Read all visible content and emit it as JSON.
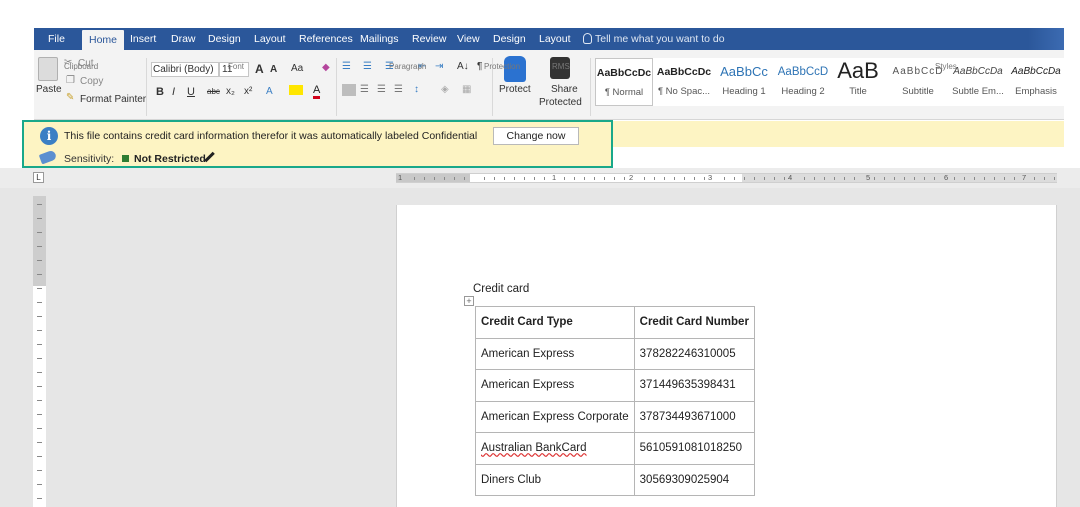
{
  "tabs": {
    "file": "File",
    "home": "Home",
    "insert": "Insert",
    "draw": "Draw",
    "design": "Design",
    "layout": "Layout",
    "references": "References",
    "mailings": "Mailings",
    "review": "Review",
    "view": "View",
    "table_design": "Design",
    "table_layout": "Layout",
    "tell_me": "Tell me what you want to do"
  },
  "clipboard": {
    "paste": "Paste",
    "cut": "Cut",
    "copy": "Copy",
    "format_painter": "Format Painter",
    "group": "Clipboard"
  },
  "font": {
    "name": "Calibri (Body)",
    "size": "11",
    "case": "Aa",
    "bold": "B",
    "italic": "I",
    "underline": "U",
    "strike": "abc",
    "sub": "x₂",
    "sup": "x²",
    "grow": "A",
    "shrink": "A",
    "group": "Font"
  },
  "paragraph": {
    "group": "Paragraph",
    "sort": "A↓",
    "pilcrow": "¶"
  },
  "protection": {
    "protect": "Protect",
    "group": "Protection"
  },
  "rms": {
    "share_line1": "Share",
    "share_line2": "Protected",
    "group": "RMS"
  },
  "styles": {
    "group": "Styles",
    "items": [
      {
        "preview": "AaBbCcDc",
        "name": "¶ Normal"
      },
      {
        "preview": "AaBbCcDc",
        "name": "¶ No Spac..."
      },
      {
        "preview": "AaBbCc",
        "name": "Heading 1"
      },
      {
        "preview": "AaBbCcD",
        "name": "Heading 2"
      },
      {
        "preview": "AaB",
        "name": "Title"
      },
      {
        "preview": "AaBbCcD",
        "name": "Subtitle"
      },
      {
        "preview": "AaBbCcDa",
        "name": "Subtle Em..."
      },
      {
        "preview": "AaBbCcDa",
        "name": "Emphasis"
      }
    ]
  },
  "notification": {
    "message": "This file contains credit card information therefor it was automatically labeled Confidential",
    "button": "Change now",
    "sensitivity_label": "Sensitivity:",
    "sensitivity_value": "Not Restricted",
    "highlight_color": "#19a88a"
  },
  "ruler": {
    "numbers": [
      "1",
      "1",
      "2",
      "3",
      "4",
      "5",
      "6",
      "7"
    ],
    "tab_marker": "L"
  },
  "document": {
    "heading": "Credit card",
    "table": {
      "headers": [
        "Credit Card Type",
        "Credit Card Number"
      ],
      "rows": [
        [
          "American Express",
          "378282246310005"
        ],
        [
          "American Express",
          "371449635398431"
        ],
        [
          "American Express Corporate",
          "378734493671000"
        ],
        [
          "Australian BankCard",
          "5610591081018250"
        ],
        [
          "Diners Club",
          "30569309025904"
        ]
      ]
    }
  },
  "colors": {
    "ribbon_blue": "#2b579a",
    "notify_bg": "#fdf4c3",
    "status_green": "#2e7d32"
  }
}
